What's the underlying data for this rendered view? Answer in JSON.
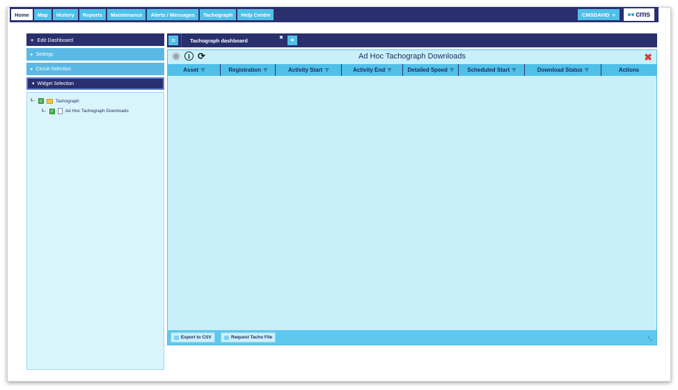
{
  "nav": {
    "items": [
      "Home",
      "Map",
      "History",
      "Reports",
      "Maintenance",
      "Alerts / Messages",
      "Tachograph",
      "Help Centre"
    ],
    "user": "CMSDAVID",
    "logo": "cms"
  },
  "sidebar": {
    "header": "Edit Dashboard",
    "sections": [
      "Settings",
      "Circuit Selection",
      "Widget Selection"
    ],
    "tree": {
      "parent": "Tachograph",
      "child": "Ad Hoc Tachograph Downloads"
    }
  },
  "tabs": {
    "active": "Tachograph dashboard"
  },
  "widget": {
    "title": "Ad Hoc Tachograph Downloads",
    "columns": [
      "Asset",
      "Registration",
      "Activity Start",
      "Activity End",
      "Detailed Speed",
      "Scheduled Start",
      "Download Status",
      "Actions"
    ],
    "footer": {
      "export": "Export to CSV",
      "request": "Request Tacho File"
    }
  },
  "colors": {
    "navy": "#2a2f6e",
    "accent": "#4fc0e8",
    "panel": "#c8f0fb",
    "close": "#e03a3a"
  }
}
